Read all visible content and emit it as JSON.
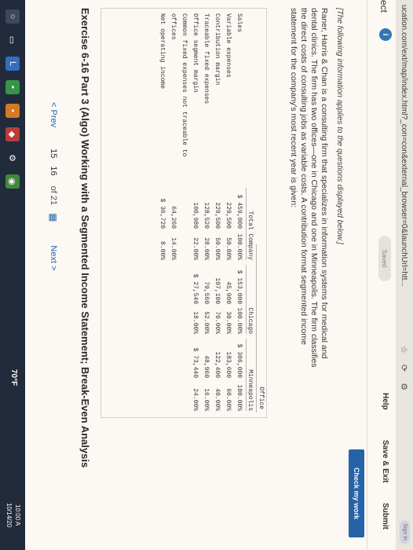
{
  "browser": {
    "url": "ucation.com/ext/map/index.html?_con=con&external_browser=0&launchUrl=htt...",
    "signin": "Sign in"
  },
  "header": {
    "section": "ect",
    "info_badge": "i",
    "saved": "Saved",
    "help": "Help",
    "save_exit": "Save & Exit",
    "submit": "Submit",
    "check_work": "Check my work"
  },
  "intro": "[The following information applies to the questions displayed below.]",
  "paragraph": "Raner, Harris & Chan is a consulting firm that specializes in information systems for medical and dental clinics. The firm has two offices—one in Chicago and one in Minneapolis. The firm classifies the direct costs of consulting jobs as variable costs. A contribution format segmented income statement for the company's most recent year is given:",
  "table": {
    "office_label": "Office",
    "columns": [
      "Total Company",
      "Chicago",
      "Minneapolis"
    ],
    "rows": [
      {
        "label": "Sales",
        "tc": "$ 459,000",
        "tcp": "100.00%",
        "ch": "$ 153,000",
        "chp": "100.00%",
        "mn": "$ 306,000",
        "mnp": "100.00%"
      },
      {
        "label": "Variable expenses",
        "tc": "229,500",
        "tcp": "50.00%",
        "ch": "45,900",
        "chp": "30.00%",
        "mn": "183,600",
        "mnp": "60.00%"
      },
      {
        "label": "Contribution margin",
        "tc": "229,500",
        "tcp": "50.00%",
        "ch": "107,100",
        "chp": "70.00%",
        "mn": "122,400",
        "mnp": "40.00%"
      },
      {
        "label": "Traceable fixed expenses",
        "tc": "128,520",
        "tcp": "28.00%",
        "ch": "79,560",
        "chp": "52.00%",
        "mn": "48,960",
        "mnp": "16.00%"
      },
      {
        "label": "Office segment margin",
        "tc": "100,980",
        "tcp": "22.00%",
        "ch": "$ 27,540",
        "chp": "18.00%",
        "mn": "$ 73,440",
        "mnp": "24.00%"
      },
      {
        "label": "Common fixed expenses not traceable to",
        "tc": "",
        "tcp": "",
        "ch": "",
        "chp": "",
        "mn": "",
        "mnp": ""
      },
      {
        "label": "  offices",
        "tc": "64,260",
        "tcp": "14.00%",
        "ch": "",
        "chp": "",
        "mn": "",
        "mnp": ""
      },
      {
        "label": "Net operating income",
        "tc": "$ 36,720",
        "tcp": "8.00%",
        "ch": "",
        "chp": "",
        "mn": "",
        "mnp": ""
      }
    ]
  },
  "exercise_title": "Exercise 6-16 Part 3 (Algo) Working with a Segmented Income Statement; Break-Even Analysis",
  "pager": {
    "prev": "< Prev",
    "page_a": "15",
    "page_b": "16",
    "of": "of 21",
    "next": "Next >"
  },
  "taskbar": {
    "weather": "70°F",
    "time": "10:00 A",
    "date": "10/14/20"
  }
}
